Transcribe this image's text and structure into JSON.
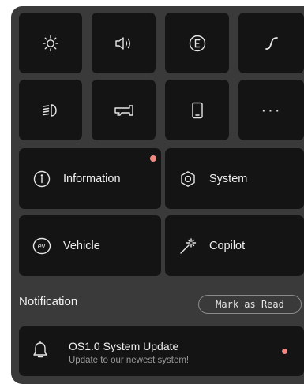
{
  "quick_actions": [
    {
      "icon": "brightness-icon"
    },
    {
      "icon": "volume-icon"
    },
    {
      "icon": "eco-mode-icon"
    },
    {
      "icon": "drive-curve-icon"
    },
    {
      "icon": "headlight-icon"
    },
    {
      "icon": "horn-icon"
    },
    {
      "icon": "phone-icon"
    },
    {
      "icon": "more-icon",
      "glyph": "···"
    }
  ],
  "menu": {
    "information": {
      "label": "Information",
      "icon": "info-icon",
      "badge_color": "#f08a80"
    },
    "system": {
      "label": "System",
      "icon": "system-hexagon-icon"
    },
    "vehicle": {
      "label": "Vehicle",
      "icon": "ev-icon",
      "icon_text": "ev"
    },
    "copilot": {
      "label": "Copilot",
      "icon": "magic-wand-icon"
    }
  },
  "notifications": {
    "title": "Notification",
    "mark_read_label": "Mark as Read",
    "items": [
      {
        "title": "OS1.0 System Update",
        "subtitle": "Update to our newest system!",
        "icon": "bell-icon",
        "unread_color": "#f08a80"
      }
    ]
  },
  "colors": {
    "panel": "#3a3a3a",
    "tile": "#141414",
    "accent": "#f08a80"
  }
}
